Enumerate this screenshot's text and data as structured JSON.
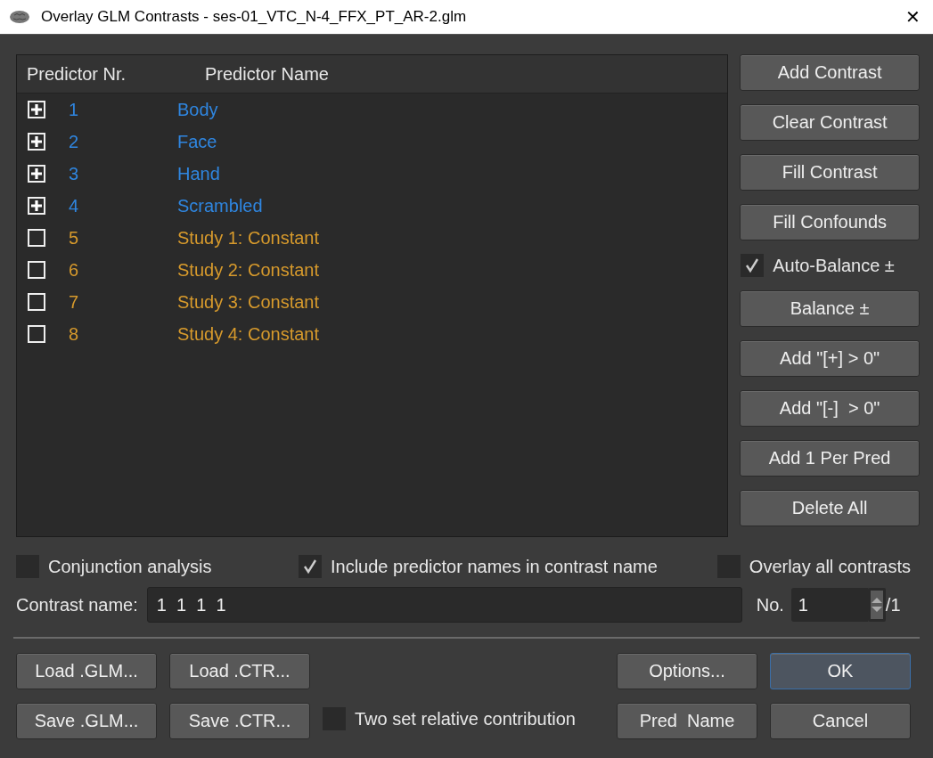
{
  "window": {
    "title": "Overlay GLM Contrasts - ses-01_VTC_N-4_FFX_PT_AR-2.glm",
    "close": "✕"
  },
  "table": {
    "columns": [
      "Predictor Nr.",
      "Predictor Name"
    ],
    "rows": [
      {
        "nr": "1",
        "name": "Body",
        "kind": "plus",
        "color": "#2f86e0"
      },
      {
        "nr": "2",
        "name": "Face",
        "kind": "plus",
        "color": "#2f86e0"
      },
      {
        "nr": "3",
        "name": "Hand",
        "kind": "plus",
        "color": "#2f86e0"
      },
      {
        "nr": "4",
        "name": "Scrambled",
        "kind": "plus",
        "color": "#2f86e0"
      },
      {
        "nr": "5",
        "name": "Study 1: Constant",
        "kind": "empty",
        "color": "#d79a2c"
      },
      {
        "nr": "6",
        "name": "Study 2: Constant",
        "kind": "empty",
        "color": "#d79a2c"
      },
      {
        "nr": "7",
        "name": "Study 3: Constant",
        "kind": "empty",
        "color": "#d79a2c"
      },
      {
        "nr": "8",
        "name": "Study 4: Constant",
        "kind": "empty",
        "color": "#d79a2c"
      }
    ]
  },
  "side_panel": [
    {
      "kind": "button",
      "label": "Add Contrast"
    },
    {
      "kind": "button",
      "label": "Clear Contrast"
    },
    {
      "kind": "button",
      "label": "Fill Contrast"
    },
    {
      "kind": "button",
      "label": "Fill Confounds"
    },
    {
      "kind": "checkbox",
      "label": "Auto-Balance ±",
      "checked": true
    },
    {
      "kind": "button",
      "label": "Balance ±"
    },
    {
      "kind": "button",
      "label": "Add \"[+] > 0\""
    },
    {
      "kind": "button",
      "label": "Add \"[-]  > 0\""
    },
    {
      "kind": "button",
      "label": "Add 1 Per Pred"
    },
    {
      "kind": "button",
      "label": "Delete All"
    }
  ],
  "options": [
    {
      "label": "Conjunction analysis",
      "checked": false
    },
    {
      "label": "Include predictor names in contrast name",
      "checked": true
    },
    {
      "label": "Overlay all contrasts",
      "checked": false
    }
  ],
  "contrast_name": {
    "label": "Contrast name:",
    "value": "1  1  1  1"
  },
  "number": {
    "label": "No.",
    "value": "1",
    "total": "/1"
  },
  "file_buttons": [
    [
      "Load .GLM...",
      "Load .CTR..."
    ],
    [
      "Save .GLM...",
      "Save .CTR..."
    ]
  ],
  "two_set": {
    "label": "Two set relative contribution",
    "checked": false
  },
  "action_buttons": [
    [
      "Options...",
      "OK"
    ],
    [
      "Pred  Name",
      "Cancel"
    ]
  ]
}
